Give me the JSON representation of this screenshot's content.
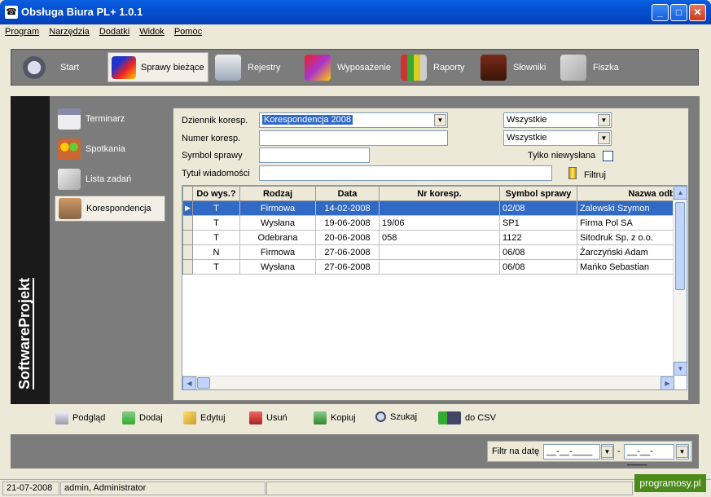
{
  "window": {
    "title": "Obsługa Biura PL+ 1.0.1"
  },
  "menu": [
    "Program",
    "Narzędzia",
    "Dodatki",
    "Widok",
    "Pomoc"
  ],
  "top_toolbar": [
    {
      "label": "Start",
      "icon": "info-icon"
    },
    {
      "label": "Sprawy bieżące",
      "icon": "cases-icon",
      "active": true
    },
    {
      "label": "Rejestry",
      "icon": "registry-icon"
    },
    {
      "label": "Wyposażenie",
      "icon": "equipment-icon"
    },
    {
      "label": "Raporty",
      "icon": "reports-icon"
    },
    {
      "label": "Słowniki",
      "icon": "books-icon"
    },
    {
      "label": "Fiszka",
      "icon": "note-icon"
    }
  ],
  "brand": "SoftwareProjekt",
  "side_nav": [
    {
      "label": "Terminarz",
      "icon": "calendar-icon"
    },
    {
      "label": "Spotkania",
      "icon": "people-icon"
    },
    {
      "label": "Lista zadań",
      "icon": "tasks-icon"
    },
    {
      "label": "Korespondencja",
      "icon": "mailbox-icon",
      "active": true
    }
  ],
  "form": {
    "dziennik_label": "Dziennik koresp.",
    "dziennik_value": "Korespondencja 2008",
    "numer_label": "Numer koresp.",
    "numer_value": "",
    "symbol_label": "Symbol sprawy",
    "symbol_value": "",
    "tytul_label": "Tytuł wiadomości",
    "tytul_value": "",
    "filter1_value": "Wszystkie",
    "filter2_value": "Wszystkie",
    "tylko_label": "Tylko niewysłana",
    "filtruj_label": "Filtruj"
  },
  "grid": {
    "columns": [
      "Do wys.?",
      "Rodzaj",
      "Data",
      "Nr koresp.",
      "Symbol sprawy",
      "Nazwa odb./"
    ],
    "rows": [
      [
        "T",
        "Firmowa",
        "14-02-2008",
        "",
        "02/08",
        "Zalewski Szymon"
      ],
      [
        "T",
        "Wysłana",
        "19-06-2008",
        "19/06",
        "SP1",
        "Firma Pol SA"
      ],
      [
        "T",
        "Odebrana",
        "20-06-2008",
        "058",
        "1122",
        "Sitodruk Sp. z o.o."
      ],
      [
        "N",
        "Firmowa",
        "27-06-2008",
        "",
        "06/08",
        "Żarczyński Adam"
      ],
      [
        "T",
        "Wysłana",
        "27-06-2008",
        "",
        "06/08",
        "Mańko Sebastian"
      ]
    ],
    "selected_row": 0
  },
  "actions": [
    "Podgląd",
    "Dodaj",
    "Edytuj",
    "Usuń",
    "Kopiuj",
    "Szukaj",
    "do CSV"
  ],
  "filter_date": {
    "label": "Filtr na datę",
    "from": "__-__-____",
    "to": "__-__-____",
    "sep": "-"
  },
  "status": {
    "date": "21-07-2008",
    "user": "admin, Administrator"
  },
  "watermark": "programosy.pl",
  "colors": {
    "selection": "#316ac5",
    "panel": "#7c7c7c",
    "titlebar": "#0450d0"
  }
}
